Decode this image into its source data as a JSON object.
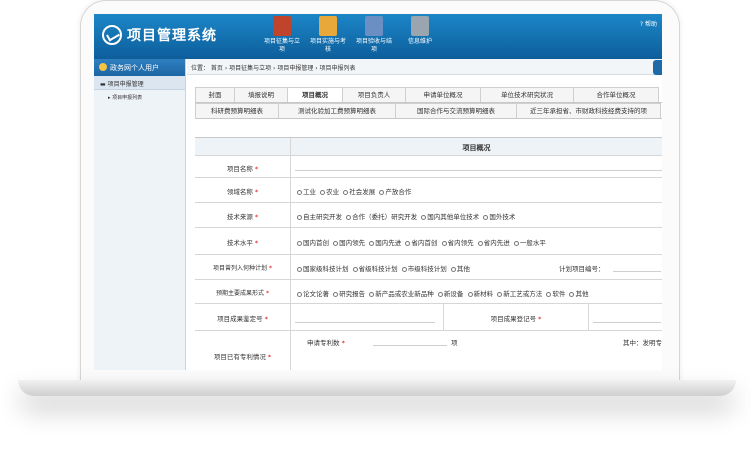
{
  "app": {
    "title": "项目管理系统",
    "help": "帮助"
  },
  "nav": [
    {
      "label": "项目征集与立项",
      "color": "#c0442b"
    },
    {
      "label": "项目实施与考核",
      "color": "#e9a93a"
    },
    {
      "label": "项目验收与结项",
      "color": "#6b8fc2"
    },
    {
      "label": "信息维护",
      "color": "#9aa5b0"
    }
  ],
  "sidebar": {
    "header": "政务网个人用户",
    "group": "项目申报管理",
    "item": "项目申报列表"
  },
  "breadcrumb": "位置： 首页 › 项目征集与立项 › 项目申报管理 › 项目申报列表",
  "tabs_row1": [
    "封面",
    "填报说明",
    "项目概况",
    "项目负责人",
    "申请单位概况",
    "单位技术研究状况",
    "合作单位概况"
  ],
  "tabs_row2": [
    "科研费预算明细表",
    "测试化验加工费预算明细表",
    "国际合作与交流预算明细表",
    "近三年承担省、市财政科技经费支持的项"
  ],
  "active_tab": "项目概况",
  "form": {
    "section_title": "项目概况",
    "project_name_label": "项目名称",
    "domain_label": "领域名称",
    "domain_options": [
      "工业",
      "农业",
      "社会发展",
      "产放合作"
    ],
    "source_label": "技术来源",
    "source_options": [
      "自主研究开发",
      "合作（委托）研究开发",
      "国内其他单位技术",
      "国外技术"
    ],
    "level_label": "技术水平",
    "level_options": [
      "国内首创",
      "国内领先",
      "国内先进",
      "省内首创",
      "省内领先",
      "省内先进",
      "一般水平"
    ],
    "plan_label": "项目曾列入何种计划",
    "plan_options": [
      "国家级科技计划",
      "省级科技计划",
      "市级科技计划",
      "其他"
    ],
    "plan_no_label": "计划项目编号：",
    "result_label": "预期主要成果形式",
    "result_options": [
      "论文论著",
      "研究报告",
      "新产品或农业新品种",
      "新设备",
      "新材料",
      "新工艺或方法",
      "软件",
      "其他"
    ],
    "result_id_label": "项目成果鉴定号",
    "result_reg_label": "项目成果登记号",
    "patent_label": "项目已有专利情况",
    "patent_apply_label": "申请专利数",
    "patent_unit": "项",
    "patent_invent_label": "其中：发明专"
  }
}
